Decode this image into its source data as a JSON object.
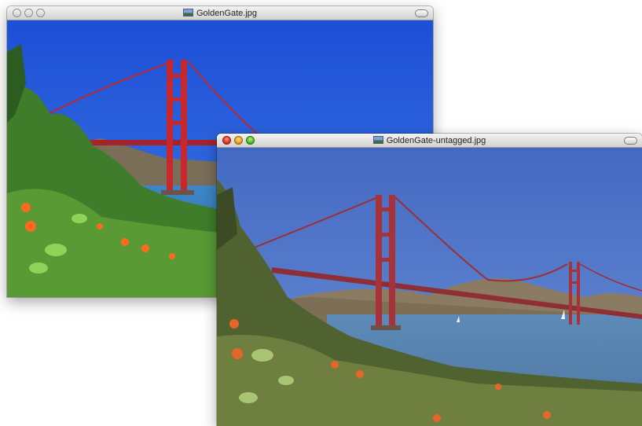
{
  "windows": {
    "back": {
      "title": "GoldenGate.jpg"
    },
    "front": {
      "title": "GoldenGate-untagged.jpg"
    }
  },
  "colors": {
    "back_sky": "#2356d8",
    "front_sky": "#4a72c8",
    "bridge_back": "#c6282e",
    "bridge_front": "#a6333a"
  }
}
